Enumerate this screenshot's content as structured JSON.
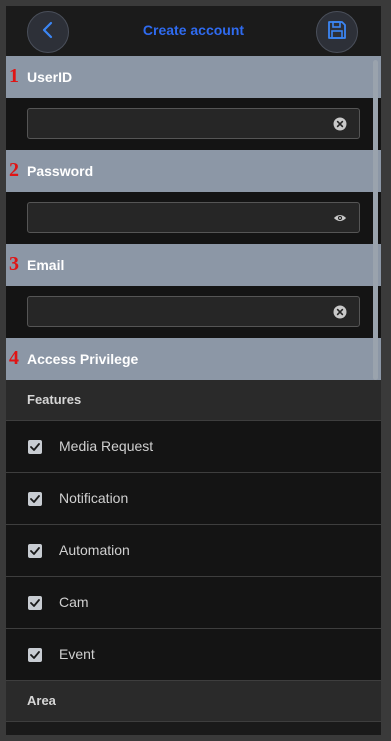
{
  "header": {
    "title": "Create account",
    "back_icon": "chevron-left-icon",
    "save_icon": "save-icon"
  },
  "sections": [
    {
      "number": "1",
      "label": "UserID"
    },
    {
      "number": "2",
      "label": "Password"
    },
    {
      "number": "3",
      "label": "Email"
    },
    {
      "number": "4",
      "label": "Access Privilege"
    }
  ],
  "fields": {
    "userid": {
      "value": "",
      "icon": "clear-icon"
    },
    "password": {
      "value": "",
      "icon": "eye-icon"
    },
    "email": {
      "value": "",
      "icon": "clear-icon"
    }
  },
  "features": {
    "label": "Features",
    "items": [
      {
        "label": "Media Request",
        "checked": true
      },
      {
        "label": "Notification",
        "checked": true
      },
      {
        "label": "Automation",
        "checked": true
      },
      {
        "label": "Cam",
        "checked": true
      },
      {
        "label": "Event",
        "checked": true
      }
    ]
  },
  "area": {
    "label": "Area"
  },
  "colors": {
    "title": "#2f6bf0",
    "section_header": "#8c97a6",
    "section_number": "#e01414",
    "background": "#1a1a1a"
  }
}
